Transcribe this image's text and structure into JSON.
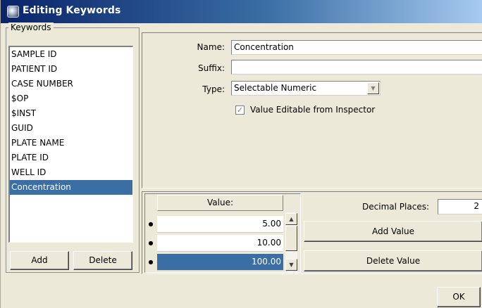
{
  "window": {
    "title": "Editing Keywords"
  },
  "keywords": {
    "legend": "Keywords",
    "items": [
      {
        "label": "SAMPLE ID",
        "selected": false
      },
      {
        "label": "PATIENT ID",
        "selected": false
      },
      {
        "label": "CASE NUMBER",
        "selected": false
      },
      {
        "label": "$OP",
        "selected": false
      },
      {
        "label": "$INST",
        "selected": false
      },
      {
        "label": "GUID",
        "selected": false
      },
      {
        "label": "PLATE NAME",
        "selected": false
      },
      {
        "label": "PLATE ID",
        "selected": false
      },
      {
        "label": "WELL ID",
        "selected": false
      },
      {
        "label": "Concentration",
        "selected": true
      }
    ],
    "add_label": "Add",
    "delete_label": "Delete"
  },
  "properties": {
    "name_label": "Name:",
    "name_value": "Concentration",
    "suffix_label": "Suffix:",
    "suffix_value": "",
    "type_label": "Type:",
    "type_value": "Selectable Numeric",
    "editable_label": "Value Editable from Inspector",
    "editable_checked": true
  },
  "values": {
    "column_header": "Value:",
    "rows": [
      {
        "value": "5.00",
        "selected": false
      },
      {
        "value": "10.00",
        "selected": false
      },
      {
        "value": "100.00",
        "selected": true
      }
    ],
    "decimal_label": "Decimal Places:",
    "decimal_value": "2",
    "add_value_label": "Add Value",
    "delete_value_label": "Delete Value"
  },
  "footer": {
    "ok_label": "OK"
  },
  "colors": {
    "selection": "#3a6ea5",
    "face": "#ece9d8",
    "title_start": "#0a246a"
  }
}
